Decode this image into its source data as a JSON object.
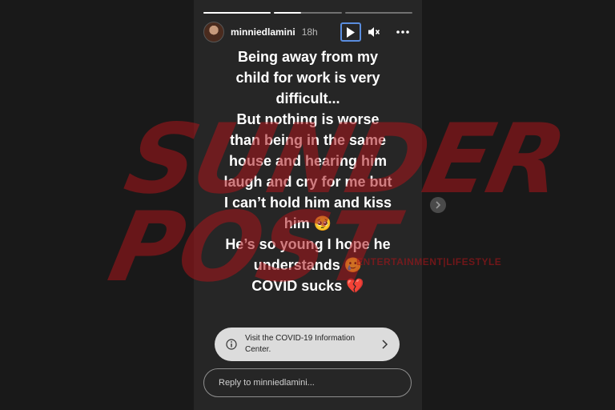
{
  "story": {
    "username": "minniedlamini",
    "time": "18h",
    "progress": [
      1,
      0.4,
      0
    ],
    "text_lines": [
      "Being away from my",
      "child for work is very",
      "difficult...",
      "But nothing is worse",
      "than being in the same",
      "house and hearing him",
      "laugh and cry for me but",
      "I can’t hold him and kiss",
      "him 🥺",
      "He’s so young I hope he",
      "understands 🥲",
      "COVID sucks 💔"
    ],
    "covid_card": {
      "line1": "Visit the COVID-19 Information",
      "line2": "Center."
    },
    "reply_placeholder": "Reply to minniedlamini..."
  },
  "watermark": {
    "word1": "SUNDER",
    "word2": "POST",
    "tagline": "ENTERTAINMENT|LIFESTYLE"
  },
  "colors": {
    "page_bg": "#191919",
    "story_bg": "#262626",
    "play_border": "#5a8dde",
    "covid_card_bg": "#dcdcdc",
    "watermark_red": "#aa1419"
  },
  "icons": [
    "play-icon",
    "mute-icon",
    "more-icon",
    "info-icon",
    "chevron-right-icon",
    "next-story-icon"
  ]
}
